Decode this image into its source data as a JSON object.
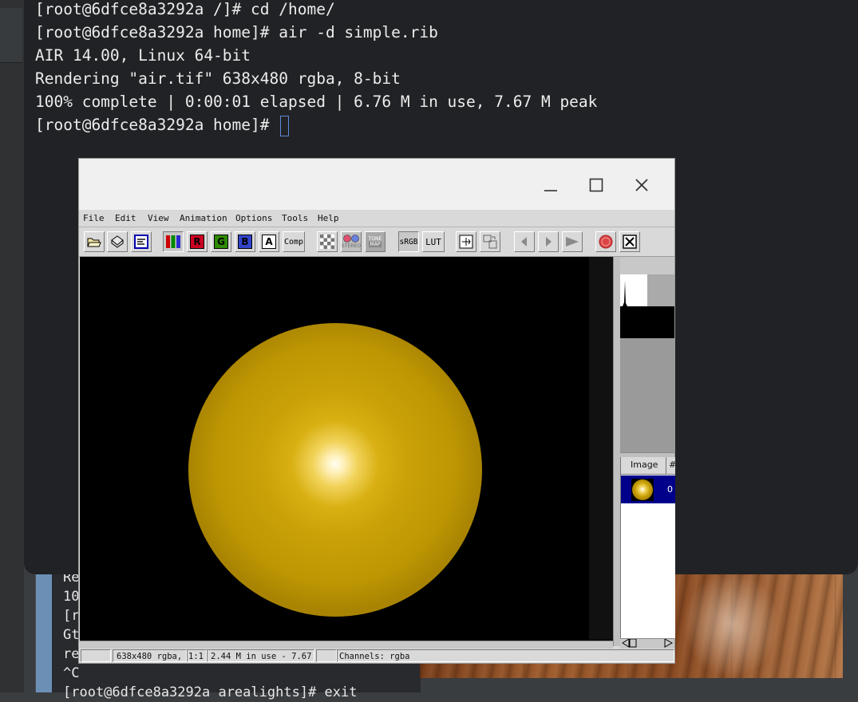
{
  "terminal": {
    "lines": [
      "[root@6dfce8a3292a /]# cd /home/",
      "[root@6dfce8a3292a home]# air -d simple.rib",
      "AIR 14.00, Linux 64-bit",
      "Rendering \"air.tif\" 638x480 rgba, 8-bit",
      "100% complete | 0:00:01 elapsed | 6.76 M in use, 7.67 M peak",
      "[root@6dfce8a3292a home]# "
    ]
  },
  "background_terminal": {
    "lines": [
      "Re",
      "10",
      "[r",
      "Gt",
      "re",
      "^C",
      "[root@6dfce8a3292a arealights]# exit"
    ]
  },
  "viewer": {
    "window_controls": {
      "minimize": "minimize",
      "maximize": "maximize",
      "close": "close"
    },
    "menu": [
      "File",
      "Edit",
      "View",
      "Animation",
      "Options",
      "Tools",
      "Help"
    ],
    "toolbar": {
      "channel_r": "R",
      "channel_g": "G",
      "channel_b": "B",
      "channel_a": "A",
      "comp": "Comp",
      "stereo": "STEREO",
      "tone_map_top": "TONE",
      "tone_map_bottom": "MAP",
      "srgb": "sRGB",
      "lut": "LUT"
    },
    "list": {
      "col_image": "Image",
      "col_num": "#",
      "row_num": "0"
    },
    "status": {
      "resolution": "638x480 rgba,",
      "zoom": "1:1",
      "memory": "2.44 M in use - 7.67",
      "channels": "Channels: rgba"
    },
    "colors": {
      "sphere": "#c9a107",
      "highlight": "#fffdf0",
      "list_selection": "#00008b"
    }
  }
}
